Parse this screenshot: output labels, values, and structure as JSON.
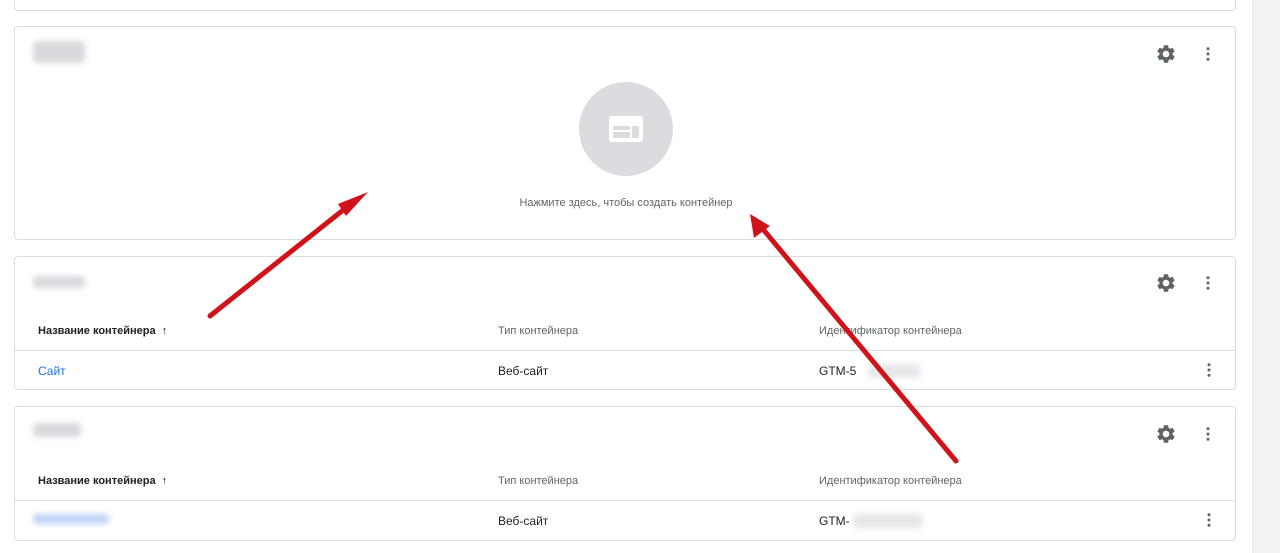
{
  "empty_account": {
    "create_prompt": "Нажмите здесь, чтобы создать контейнер"
  },
  "table_headers": {
    "name": "Название контейнера",
    "name_sort_arrow": "↑",
    "type": "Тип контейнера",
    "id": "Идентификатор контейнера"
  },
  "accounts": [
    {
      "rows": [
        {
          "name": "Сайт",
          "type": "Веб-сайт",
          "id": "GTM-5"
        }
      ]
    },
    {
      "rows": [
        {
          "name": "",
          "type": "Веб-сайт",
          "id": "GTM-"
        }
      ]
    }
  ],
  "icons": {
    "settings": "gear-icon",
    "more": "more-vert-icon",
    "container": "web-container-icon"
  },
  "colors": {
    "link": "#1a73e8",
    "annotation_arrow": "#d0131b",
    "empty_circle": "#dadce0"
  }
}
